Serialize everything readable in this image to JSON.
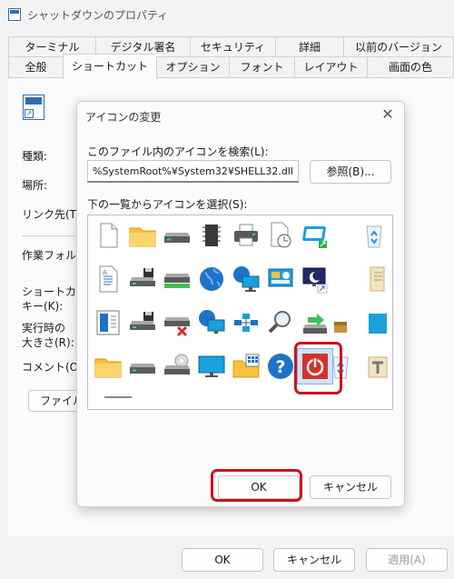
{
  "window": {
    "title": "シャットダウンのプロパティ"
  },
  "tabs_row1": [
    "ターミナル",
    "デジタル署名",
    "セキュリティ",
    "詳細",
    "以前のバージョン"
  ],
  "tabs_row2": [
    "全般",
    "ショートカット",
    "オプション",
    "フォント",
    "レイアウト",
    "画面の色"
  ],
  "active_tab": "ショートカット",
  "properties": {
    "labels": [
      "種類:",
      "場所:",
      "リンク先(T):",
      "作業フォルダ",
      "ショートカット\nキー(K):",
      "実行時の\n大きさ(R):",
      "コメント(O):"
    ],
    "open_location_button": "ファイルの場所を開く(F)"
  },
  "dialog": {
    "title": "アイコンの変更",
    "search_label": "このファイル内のアイコンを検索(L):",
    "path_value": "%SystemRoot%¥System32¥SHELL32.dll",
    "browse_button": "参照(B)...",
    "list_label": "下の一覧からアイコンを選択(S):",
    "ok_button": "OK",
    "cancel_button": "キャンセル",
    "selected_icon": "power-icon"
  },
  "icons": [
    [
      "document-icon",
      "folder-icon",
      "drive-icon",
      "chip-icon",
      "printer-icon",
      "document-clock-icon",
      "window-icon",
      "recycle-bin-icon"
    ],
    [
      "text-document-icon",
      "floppy-drive-icon",
      "drive-green-icon",
      "globe-icon",
      "network-globe-icon",
      "control-panel-icon",
      "moon-monitor-icon",
      "folder-file-icon"
    ],
    [
      "window-document-icon",
      "floppy-drive-icon",
      "drive-error-icon",
      "globe-monitor-icon",
      "network-icon",
      "magnifier-icon",
      "network-drive-icon",
      "box-icon"
    ],
    [
      "folder-icon",
      "drive-icon",
      "cd-drive-icon",
      "monitor-icon",
      "folder-grid-icon",
      "help-icon",
      "power-icon",
      "recycle-bin-full-icon"
    ]
  ],
  "footer": {
    "ok": "OK",
    "cancel": "キャンセル",
    "apply": "適用(A)"
  },
  "colors": {
    "accent": "#0067c0",
    "highlight": "#d0121b",
    "folder": "#f7c13f"
  }
}
